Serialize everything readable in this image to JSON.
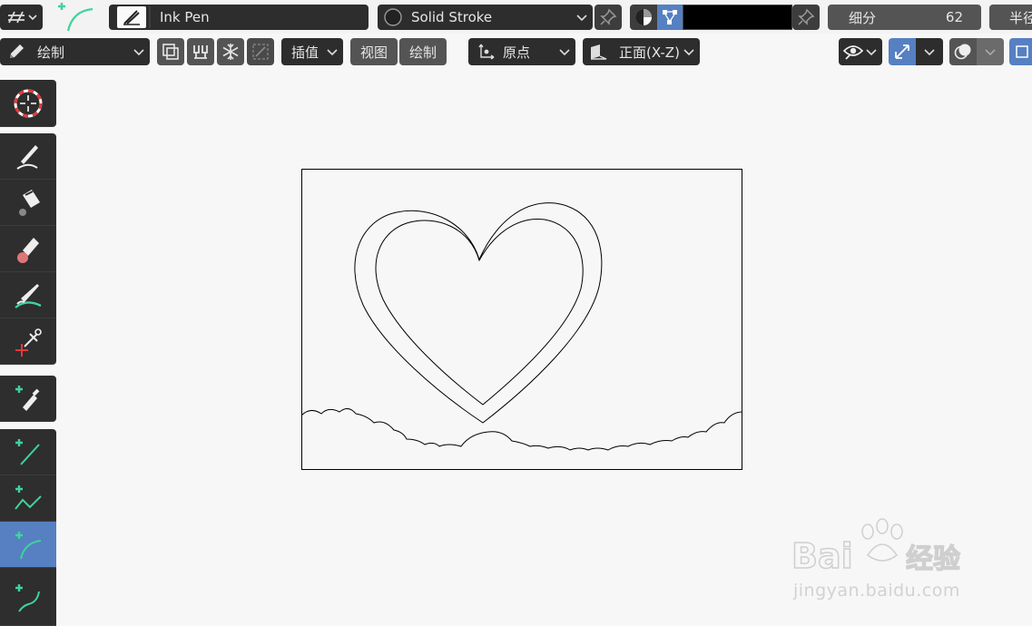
{
  "header": {
    "brush_name": "Ink Pen",
    "material_name": "Solid Stroke",
    "subdivision_label": "细分",
    "subdivision_value": "62",
    "radius_label_partial": "半径"
  },
  "toolbar2": {
    "mode_label": "绘制",
    "interpolate_label": "插值",
    "view_label": "视图",
    "draw_label": "绘制",
    "origin_label": "原点",
    "plane_label": "正面(X-Z)"
  },
  "tools": [
    {
      "name": "cursor-tool"
    },
    {
      "name": "draw-tool"
    },
    {
      "name": "fill-tool"
    },
    {
      "name": "erase-tool"
    },
    {
      "name": "tint-tool"
    },
    {
      "name": "cutter-tool"
    },
    {
      "name": "eyedropper-tool"
    },
    {
      "name": "line-tool"
    },
    {
      "name": "polyline-tool"
    },
    {
      "name": "arc-tool",
      "active": true
    },
    {
      "name": "curve-tool"
    }
  ],
  "colors": {
    "accent": "#5680c2",
    "panel": "#2d2d2d",
    "canvas_bg": "#f7f7f7",
    "stroke_color": "#000000"
  },
  "watermark": {
    "brand": "Bai du 经验",
    "url": "jingyan.baidu.com"
  }
}
